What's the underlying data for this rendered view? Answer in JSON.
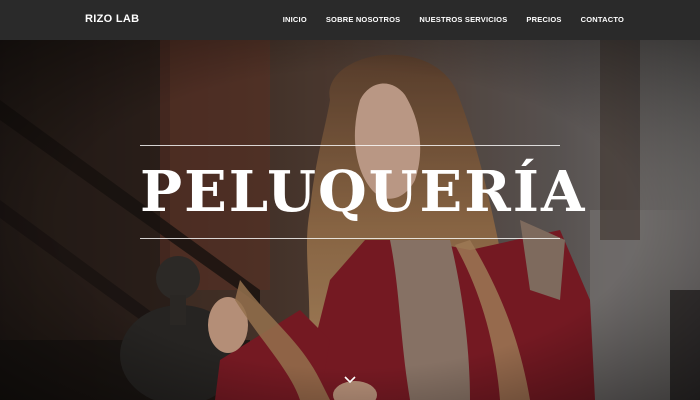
{
  "navbar": {
    "brand": "RIZO LAB",
    "links": [
      {
        "label": "INICIO"
      },
      {
        "label": "SOBRE NOSOTROS"
      },
      {
        "label": "NUESTROS SERVICIOS"
      },
      {
        "label": "PRECIOS"
      },
      {
        "label": "CONTACTO"
      }
    ]
  },
  "hero": {
    "title": "PELUQUERÍA",
    "scroll_icon": "chevron-down-icon"
  },
  "colors": {
    "navbar_bg": "#2a2a2a",
    "text": "#ffffff"
  }
}
